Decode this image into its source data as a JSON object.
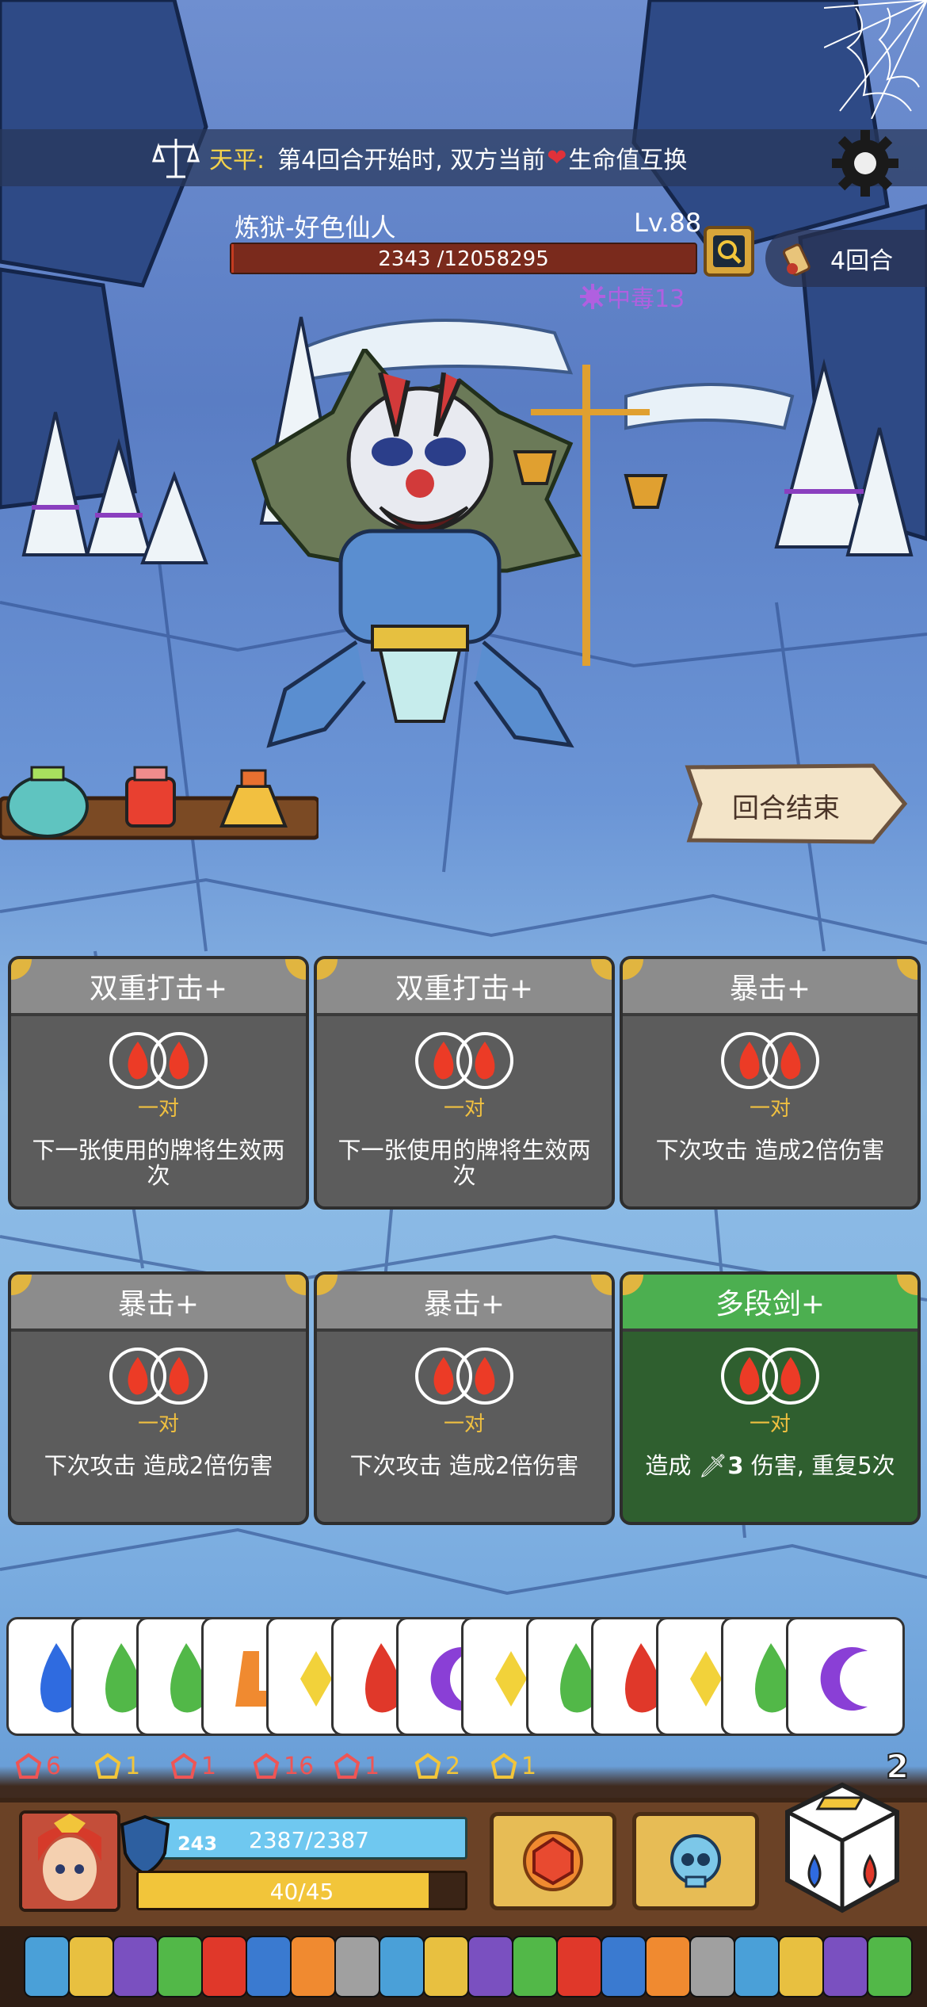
{
  "banner": {
    "icon": "scale-icon",
    "label": "天平:",
    "text": "第4回合开始时, 双方当前",
    "text2": "生命值互换"
  },
  "enemy": {
    "name": "炼狱-好色仙人",
    "level": "Lv.88",
    "hp_text": "2343 /12058295",
    "hp_fraction": 0.000194,
    "status": "中毒13"
  },
  "round": {
    "label": "4回合"
  },
  "end_turn": {
    "label": "回合结束"
  },
  "cards": [
    {
      "title": "双重打击+",
      "pair": "一对",
      "desc": "下一张使用的牌将生效两次",
      "color": "gray"
    },
    {
      "title": "双重打击+",
      "pair": "一对",
      "desc": "下一张使用的牌将生效两次",
      "color": "gray"
    },
    {
      "title": "暴击+",
      "pair": "一对",
      "desc": "下次攻击 造成2倍伤害",
      "color": "gray"
    },
    {
      "title": "暴击+",
      "pair": "一对",
      "desc": "下次攻击 造成2倍伤害",
      "color": "gray"
    },
    {
      "title": "暴击+",
      "pair": "一对",
      "desc": "下次攻击 造成2倍伤害",
      "color": "gray"
    },
    {
      "title": "多段剑+",
      "pair": "一对",
      "desc_pre": "造成",
      "desc_num": "3",
      "desc_post": "伤害, 重复5次",
      "color": "green"
    }
  ],
  "hand": [
    "water-blue",
    "leaf-green",
    "leaf-green",
    "boot-orange",
    "gem-yellow",
    "fire-red",
    "moon-purple",
    "gem-yellow",
    "leaf-green",
    "fire-red",
    "gem-yellow",
    "leaf-green",
    "moon-purple"
  ],
  "stats": [
    {
      "icon": "wing-icon",
      "value": "6"
    },
    {
      "icon": "shield-up-icon",
      "value": "1"
    },
    {
      "icon": "heart-shield-icon",
      "value": "1"
    },
    {
      "icon": "rune-icon",
      "value": "16"
    },
    {
      "icon": "lotus-icon",
      "value": "1"
    },
    {
      "icon": "double-arrow-icon",
      "value": "2"
    },
    {
      "icon": "triangle-icon",
      "value": "1"
    }
  ],
  "dice_count": "2",
  "player": {
    "armor": "243",
    "hp_text": "2387/2387",
    "energy_text": "40/45",
    "energy_fraction": 0.889
  },
  "colors": {
    "banner_label": "#f4d24a",
    "poison": "#b060e0",
    "stat_red": "#e55",
    "stat_yellow": "#f2c53a",
    "card_gray": "#5c5c5c",
    "card_green": "#2f5f2f"
  }
}
